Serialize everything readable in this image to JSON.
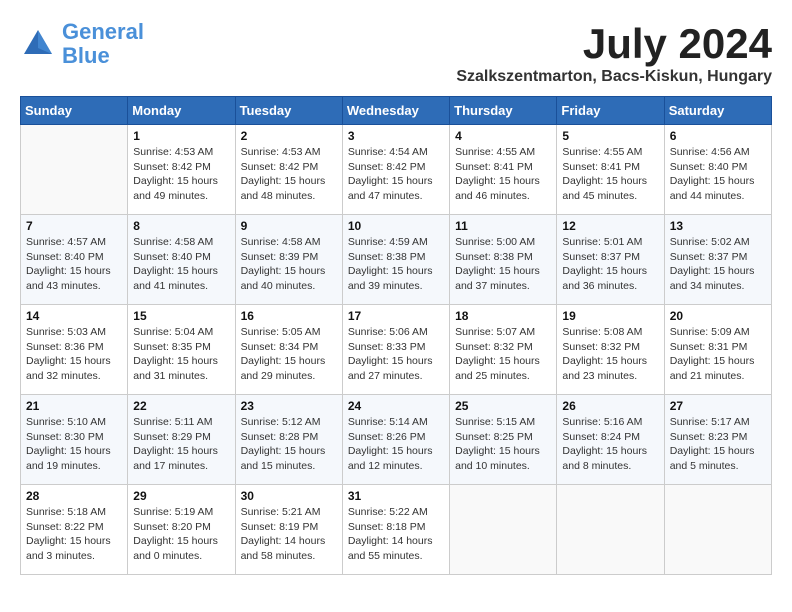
{
  "header": {
    "logo_line1": "General",
    "logo_line2": "Blue",
    "month": "July 2024",
    "location": "Szalkszentmarton, Bacs-Kiskun, Hungary"
  },
  "weekdays": [
    "Sunday",
    "Monday",
    "Tuesday",
    "Wednesday",
    "Thursday",
    "Friday",
    "Saturday"
  ],
  "weeks": [
    [
      {
        "day": "",
        "info": ""
      },
      {
        "day": "1",
        "info": "Sunrise: 4:53 AM\nSunset: 8:42 PM\nDaylight: 15 hours\nand 49 minutes."
      },
      {
        "day": "2",
        "info": "Sunrise: 4:53 AM\nSunset: 8:42 PM\nDaylight: 15 hours\nand 48 minutes."
      },
      {
        "day": "3",
        "info": "Sunrise: 4:54 AM\nSunset: 8:42 PM\nDaylight: 15 hours\nand 47 minutes."
      },
      {
        "day": "4",
        "info": "Sunrise: 4:55 AM\nSunset: 8:41 PM\nDaylight: 15 hours\nand 46 minutes."
      },
      {
        "day": "5",
        "info": "Sunrise: 4:55 AM\nSunset: 8:41 PM\nDaylight: 15 hours\nand 45 minutes."
      },
      {
        "day": "6",
        "info": "Sunrise: 4:56 AM\nSunset: 8:40 PM\nDaylight: 15 hours\nand 44 minutes."
      }
    ],
    [
      {
        "day": "7",
        "info": "Sunrise: 4:57 AM\nSunset: 8:40 PM\nDaylight: 15 hours\nand 43 minutes."
      },
      {
        "day": "8",
        "info": "Sunrise: 4:58 AM\nSunset: 8:40 PM\nDaylight: 15 hours\nand 41 minutes."
      },
      {
        "day": "9",
        "info": "Sunrise: 4:58 AM\nSunset: 8:39 PM\nDaylight: 15 hours\nand 40 minutes."
      },
      {
        "day": "10",
        "info": "Sunrise: 4:59 AM\nSunset: 8:38 PM\nDaylight: 15 hours\nand 39 minutes."
      },
      {
        "day": "11",
        "info": "Sunrise: 5:00 AM\nSunset: 8:38 PM\nDaylight: 15 hours\nand 37 minutes."
      },
      {
        "day": "12",
        "info": "Sunrise: 5:01 AM\nSunset: 8:37 PM\nDaylight: 15 hours\nand 36 minutes."
      },
      {
        "day": "13",
        "info": "Sunrise: 5:02 AM\nSunset: 8:37 PM\nDaylight: 15 hours\nand 34 minutes."
      }
    ],
    [
      {
        "day": "14",
        "info": "Sunrise: 5:03 AM\nSunset: 8:36 PM\nDaylight: 15 hours\nand 32 minutes."
      },
      {
        "day": "15",
        "info": "Sunrise: 5:04 AM\nSunset: 8:35 PM\nDaylight: 15 hours\nand 31 minutes."
      },
      {
        "day": "16",
        "info": "Sunrise: 5:05 AM\nSunset: 8:34 PM\nDaylight: 15 hours\nand 29 minutes."
      },
      {
        "day": "17",
        "info": "Sunrise: 5:06 AM\nSunset: 8:33 PM\nDaylight: 15 hours\nand 27 minutes."
      },
      {
        "day": "18",
        "info": "Sunrise: 5:07 AM\nSunset: 8:32 PM\nDaylight: 15 hours\nand 25 minutes."
      },
      {
        "day": "19",
        "info": "Sunrise: 5:08 AM\nSunset: 8:32 PM\nDaylight: 15 hours\nand 23 minutes."
      },
      {
        "day": "20",
        "info": "Sunrise: 5:09 AM\nSunset: 8:31 PM\nDaylight: 15 hours\nand 21 minutes."
      }
    ],
    [
      {
        "day": "21",
        "info": "Sunrise: 5:10 AM\nSunset: 8:30 PM\nDaylight: 15 hours\nand 19 minutes."
      },
      {
        "day": "22",
        "info": "Sunrise: 5:11 AM\nSunset: 8:29 PM\nDaylight: 15 hours\nand 17 minutes."
      },
      {
        "day": "23",
        "info": "Sunrise: 5:12 AM\nSunset: 8:28 PM\nDaylight: 15 hours\nand 15 minutes."
      },
      {
        "day": "24",
        "info": "Sunrise: 5:14 AM\nSunset: 8:26 PM\nDaylight: 15 hours\nand 12 minutes."
      },
      {
        "day": "25",
        "info": "Sunrise: 5:15 AM\nSunset: 8:25 PM\nDaylight: 15 hours\nand 10 minutes."
      },
      {
        "day": "26",
        "info": "Sunrise: 5:16 AM\nSunset: 8:24 PM\nDaylight: 15 hours\nand 8 minutes."
      },
      {
        "day": "27",
        "info": "Sunrise: 5:17 AM\nSunset: 8:23 PM\nDaylight: 15 hours\nand 5 minutes."
      }
    ],
    [
      {
        "day": "28",
        "info": "Sunrise: 5:18 AM\nSunset: 8:22 PM\nDaylight: 15 hours\nand 3 minutes."
      },
      {
        "day": "29",
        "info": "Sunrise: 5:19 AM\nSunset: 8:20 PM\nDaylight: 15 hours\nand 0 minutes."
      },
      {
        "day": "30",
        "info": "Sunrise: 5:21 AM\nSunset: 8:19 PM\nDaylight: 14 hours\nand 58 minutes."
      },
      {
        "day": "31",
        "info": "Sunrise: 5:22 AM\nSunset: 8:18 PM\nDaylight: 14 hours\nand 55 minutes."
      },
      {
        "day": "",
        "info": ""
      },
      {
        "day": "",
        "info": ""
      },
      {
        "day": "",
        "info": ""
      }
    ]
  ]
}
